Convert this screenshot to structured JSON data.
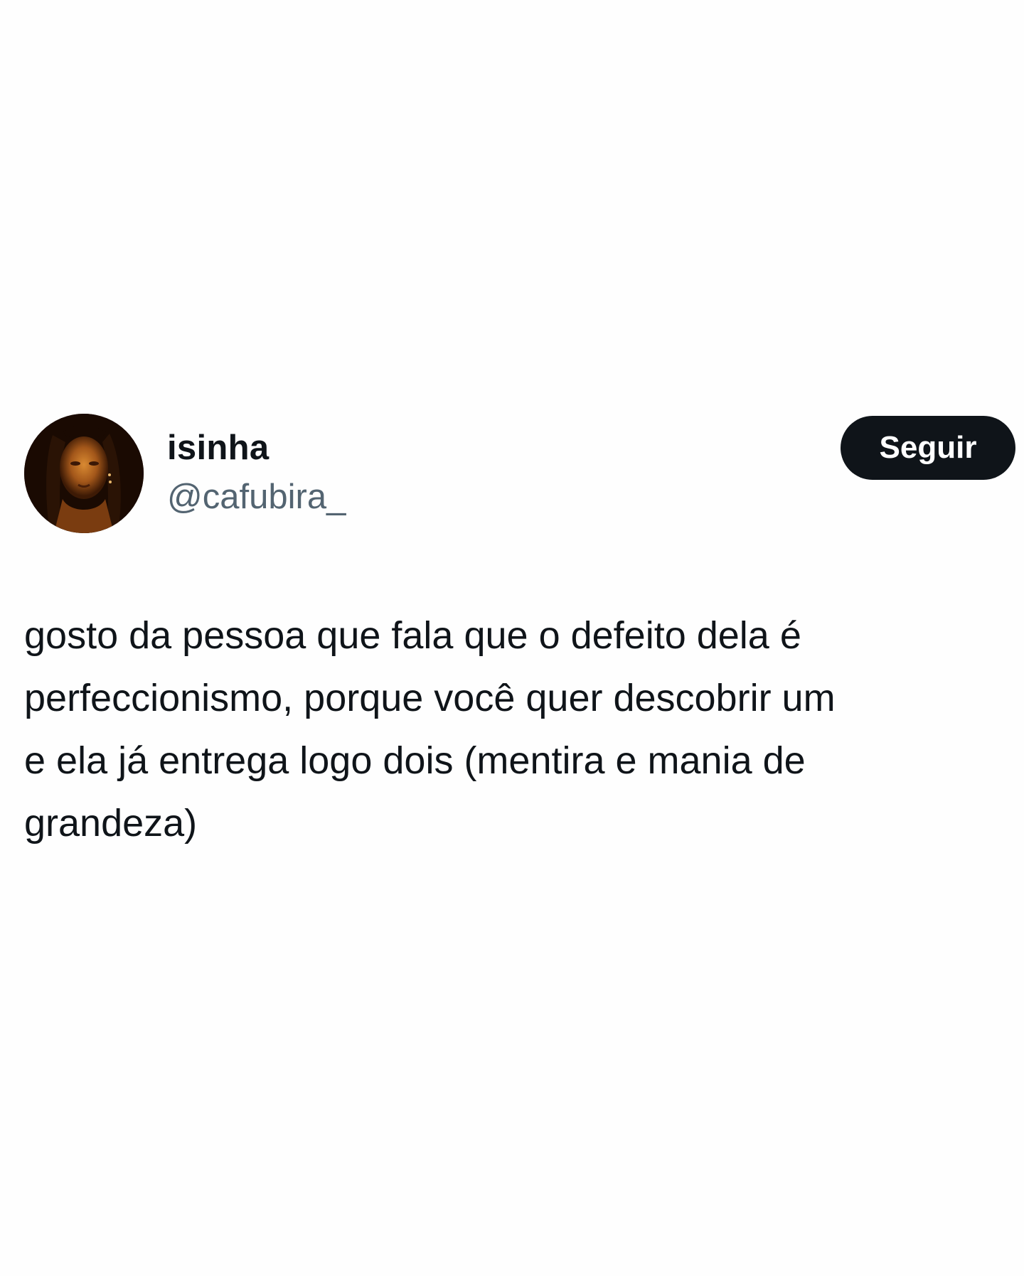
{
  "user": {
    "display_name": "isinha",
    "handle": "@cafubira_"
  },
  "follow_button": {
    "label": "Seguir"
  },
  "tweet": {
    "text": "gosto da pessoa que fala que o defeito dela é\nperfeccionismo, porque você quer descobrir um\ne ela já entrega logo dois (mentira e mania de\ngrandeza)"
  },
  "colors": {
    "background": "#fefefe",
    "text": "#0f1419",
    "handle": "#536471",
    "button_bg": "#0f1419",
    "button_text": "#ffffff"
  }
}
